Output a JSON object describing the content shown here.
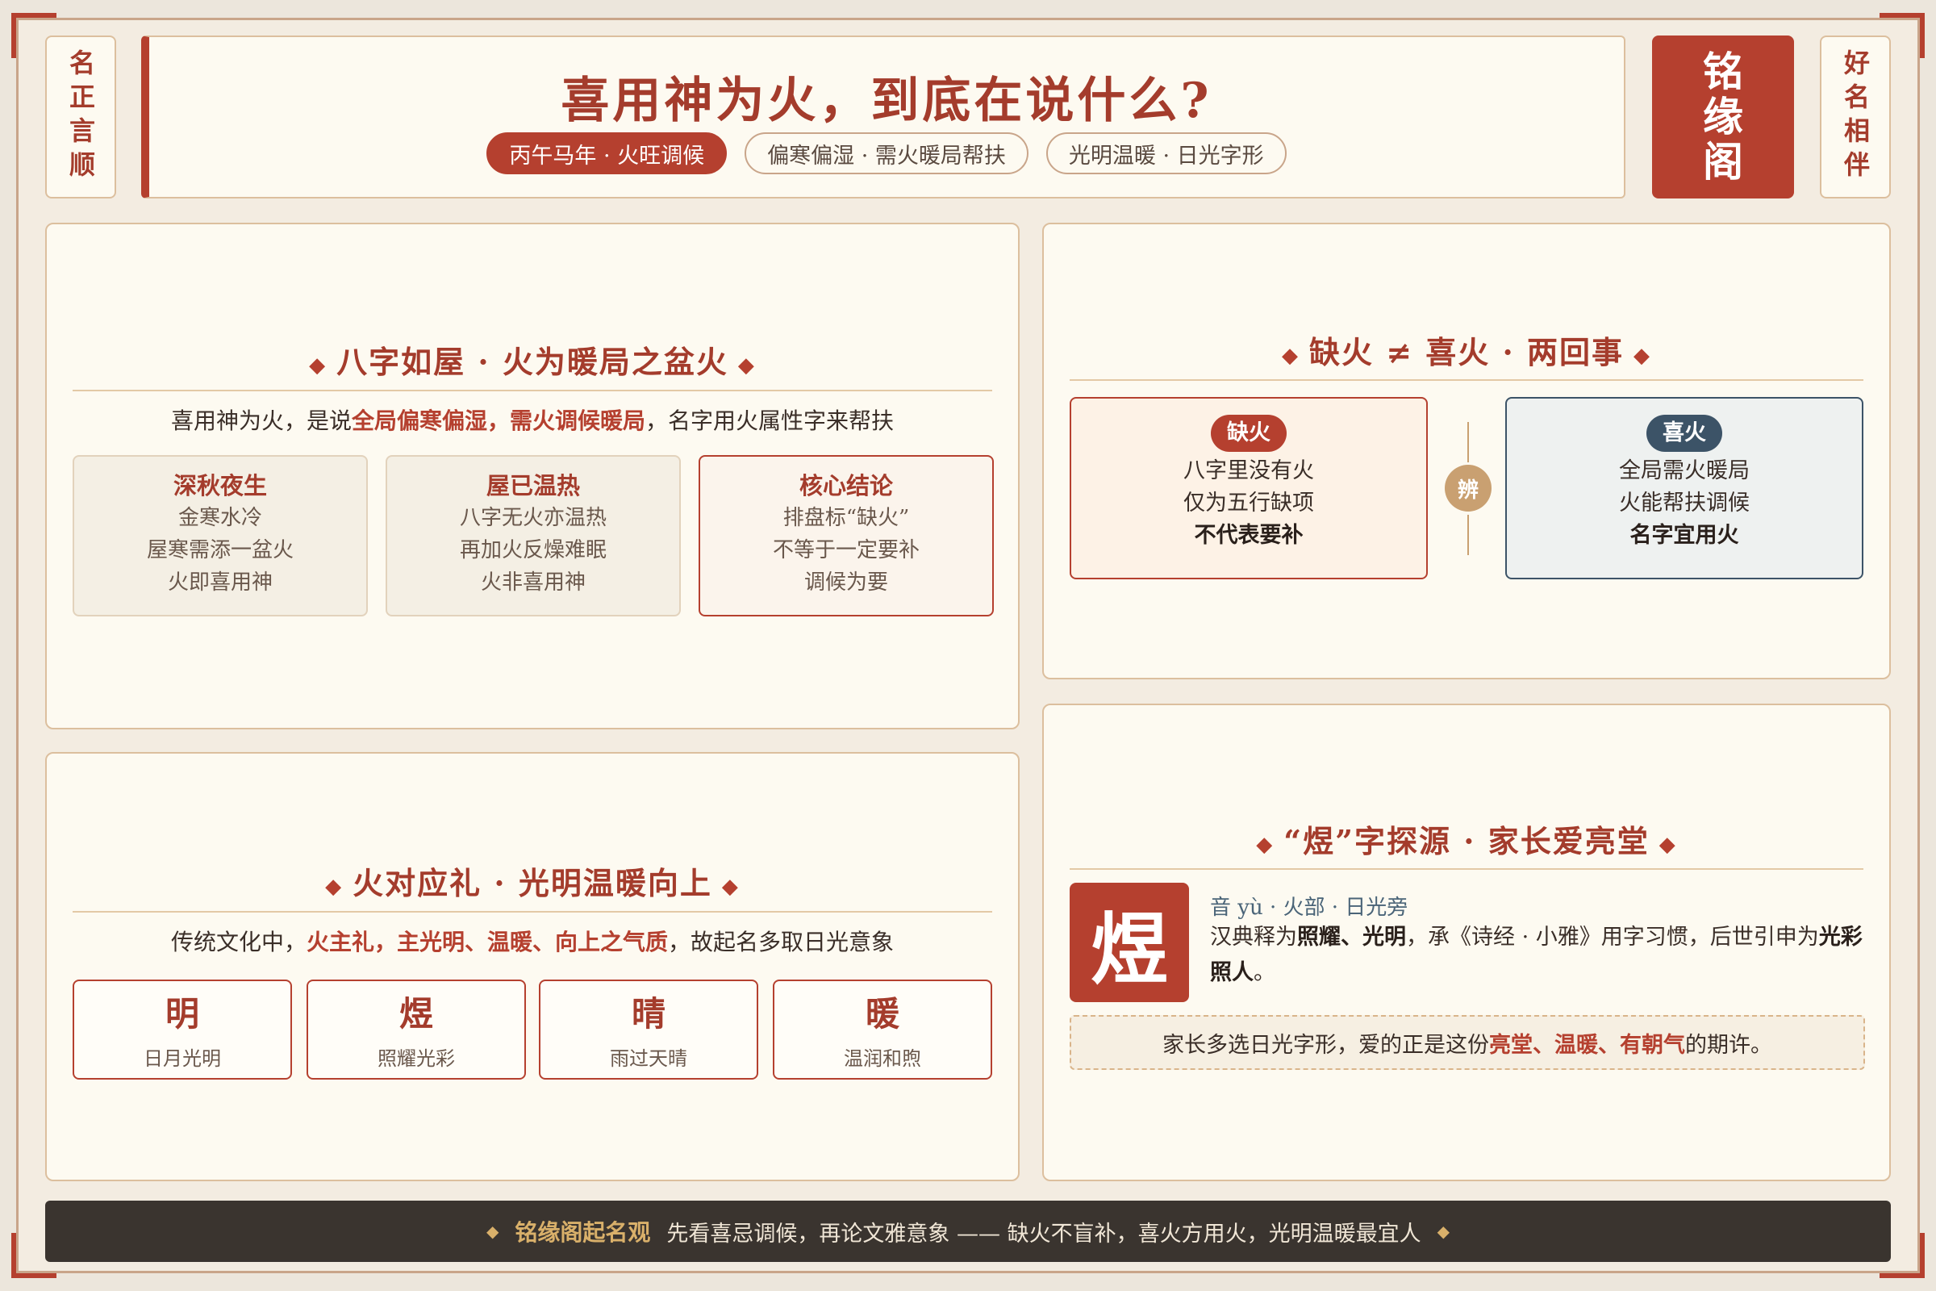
{
  "side_left": "名正言顺",
  "side_right": "好名相伴",
  "header": {
    "title": "喜用神为火，到底在说什么?",
    "pills": [
      "丙午马年 · 火旺调候",
      "偏寒偏湿 · 需火暖局帮扶",
      "光明温暖 · 日光字形"
    ]
  },
  "seal": [
    "铭",
    "缘",
    "阁"
  ],
  "house": {
    "title": "八字如屋 · 火为暖局之盆火",
    "lead_pre": "喜用神为火，是说",
    "lead_hl": "全局偏寒偏湿，需火调候暖局",
    "lead_post": "，名字用火属性字来帮扶",
    "cards": [
      {
        "title": "深秋夜生",
        "lines": [
          "金寒水冷",
          "屋寒需添一盆火",
          "火即喜用神"
        ]
      },
      {
        "title": "屋已温热",
        "lines": [
          "八字无火亦温热",
          "再加火反燥难眠",
          "火非喜用神"
        ]
      },
      {
        "title": "核心结论",
        "lines": [
          "排盘标“缺火”",
          "不等于一定要补",
          "调候为要"
        ]
      }
    ]
  },
  "diff": {
    "title": "缺火 ≠ 喜火 · 两回事",
    "left": {
      "badge": "缺火",
      "lines": [
        "八字里没有火",
        "仅为五行缺项"
      ],
      "strong": "不代表要补"
    },
    "mid": "辨",
    "right": {
      "badge": "喜火",
      "lines": [
        "全局需火暖局",
        "火能帮扶调候"
      ],
      "strong": "名字宜用火"
    }
  },
  "ritual": {
    "title": "火对应礼 · 光明温暖向上",
    "lead_pre": "传统文化中，",
    "lead_hl": "火主礼，主光明、温暖、向上之气质",
    "lead_post": "，故起名多取日光意象",
    "chars": [
      {
        "ch": "明",
        "sub": "日月光明"
      },
      {
        "ch": "煜",
        "sub": "照耀光彩"
      },
      {
        "ch": "晴",
        "sub": "雨过天晴"
      },
      {
        "ch": "暖",
        "sub": "温润和煦"
      }
    ]
  },
  "origin": {
    "title": "“煜”字探源 · 家长爱亮堂",
    "char": "煜",
    "meta": "音 yù · 火部 · 日光旁",
    "desc_1": "汉典释为",
    "desc_b1": "照耀、光明",
    "desc_2": "，承《诗经 · 小雅》用字习惯，后世引申为",
    "desc_b2": "光彩照人",
    "desc_3": "。",
    "note_pre": "家长多选日光字形，爱的正是这份",
    "note_hl": "亮堂、温暖、有朝气",
    "note_post": "的期许。"
  },
  "footer": {
    "brand": "铭缘阁起名观",
    "text": "先看喜忌调候，再论文雅意象 —— 缺火不盲补，喜火方用火，光明温暖最宜人"
  }
}
